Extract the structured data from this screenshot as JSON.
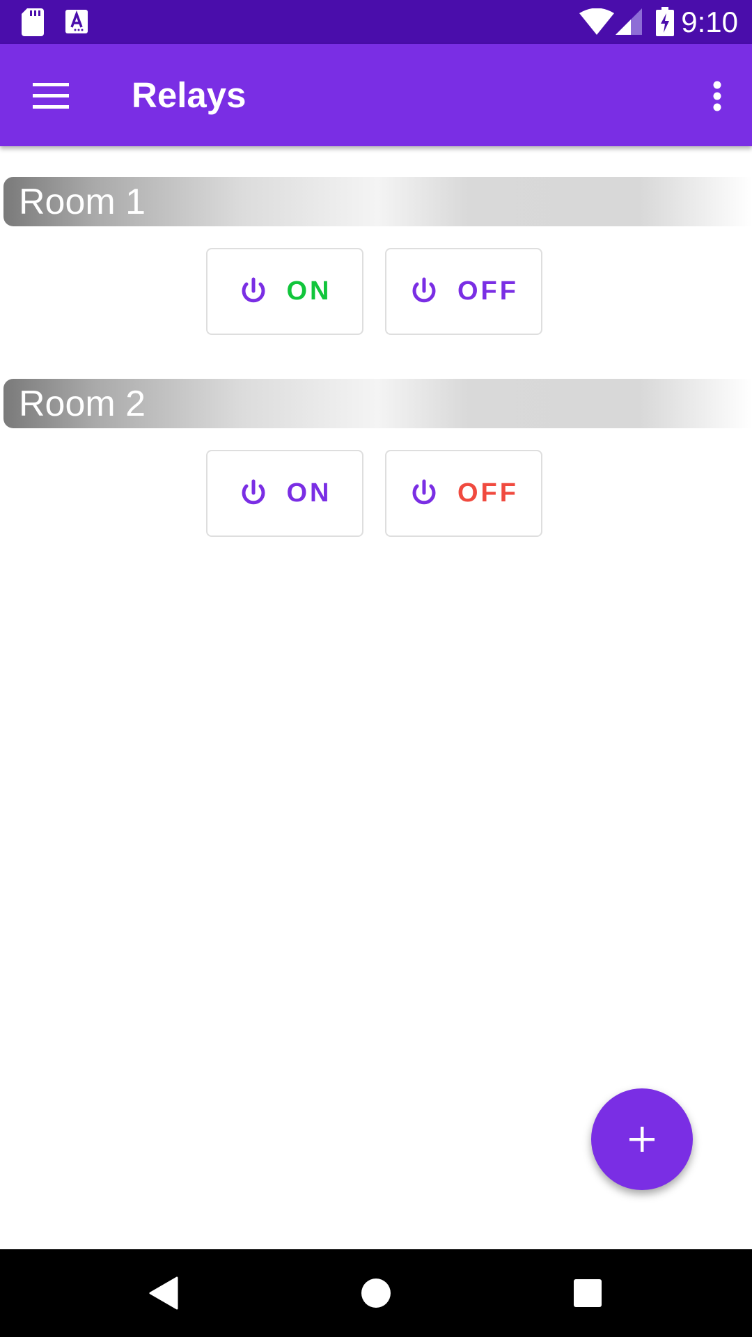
{
  "status_bar": {
    "time": "9:10",
    "icons": [
      "sd-card-icon",
      "text-a-icon",
      "wifi-icon",
      "cell-signal-icon",
      "battery-charging-icon"
    ]
  },
  "app_bar": {
    "title": "Relays",
    "menu_icon": "hamburger-menu-icon",
    "overflow_icon": "more-vert-icon",
    "background": "#7a2ee4"
  },
  "rooms": [
    {
      "name": "Room 1",
      "on_label": "ON",
      "off_label": "OFF",
      "on_color": "#11c53b",
      "off_color": "#7a2ee4"
    },
    {
      "name": "Room 2",
      "on_label": "ON",
      "off_label": "OFF",
      "on_color": "#7a2ee4",
      "off_color": "#f04a3f"
    }
  ],
  "fab": {
    "icon": "plus-icon"
  },
  "nav_bar": {
    "icons": [
      "back-icon",
      "home-icon",
      "recents-icon"
    ]
  },
  "colors": {
    "accent": "#7a2ee4",
    "status_bar": "#4a0dab",
    "on_active": "#11c53b",
    "off_active": "#f04a3f"
  }
}
